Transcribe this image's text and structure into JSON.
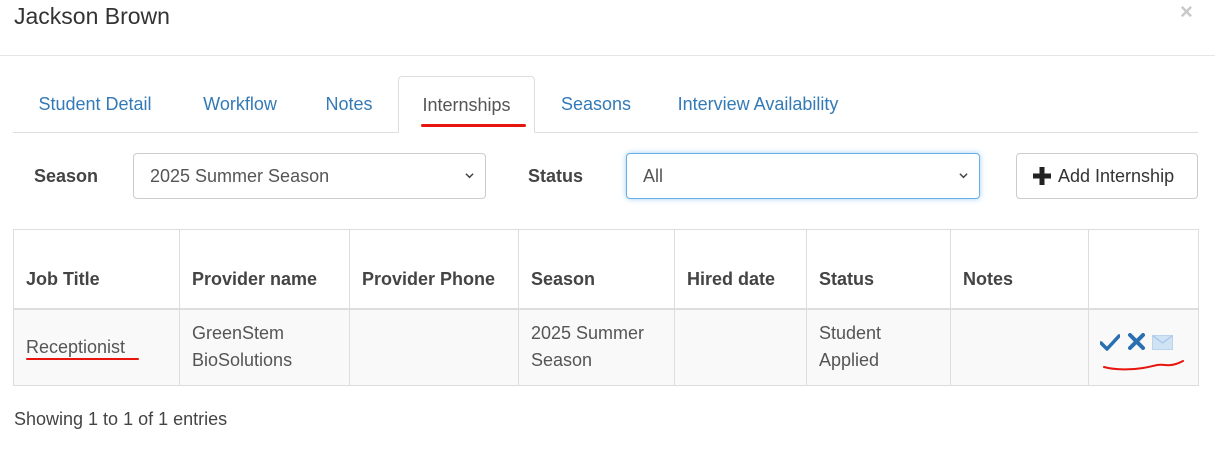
{
  "modal": {
    "title": "Jackson Brown",
    "close_glyph": "×"
  },
  "tabs": [
    {
      "label": "Student Detail",
      "active": false
    },
    {
      "label": "Workflow",
      "active": false
    },
    {
      "label": "Notes",
      "active": false
    },
    {
      "label": "Internships",
      "active": true
    },
    {
      "label": "Seasons",
      "active": false
    },
    {
      "label": "Interview Availability",
      "active": false
    }
  ],
  "filters": {
    "season_label": "Season",
    "season_value": "2025 Summer Season",
    "status_label": "Status",
    "status_value": "All",
    "add_button_label": "Add Internship",
    "add_button_icon": "plus-icon"
  },
  "table": {
    "headers": [
      "Job Title",
      "Provider name",
      "Provider Phone",
      "Season",
      "Hired date",
      "Status",
      "Notes",
      ""
    ],
    "rows": [
      {
        "job_title": "Receptionist",
        "provider_name": "GreenStem BioSolutions",
        "provider_phone": "",
        "season": "2025 Summer Season",
        "hired_date": "",
        "status": "Student Applied",
        "notes": "",
        "actions": [
          "check-icon",
          "x-icon",
          "envelope-icon"
        ]
      }
    ]
  },
  "footer": {
    "info": "Showing 1 to 1 of 1 entries"
  },
  "colors": {
    "link": "#337ab7",
    "annotation_red": "#e8150f",
    "focus_border": "#66afe9",
    "border": "#dddddd"
  }
}
